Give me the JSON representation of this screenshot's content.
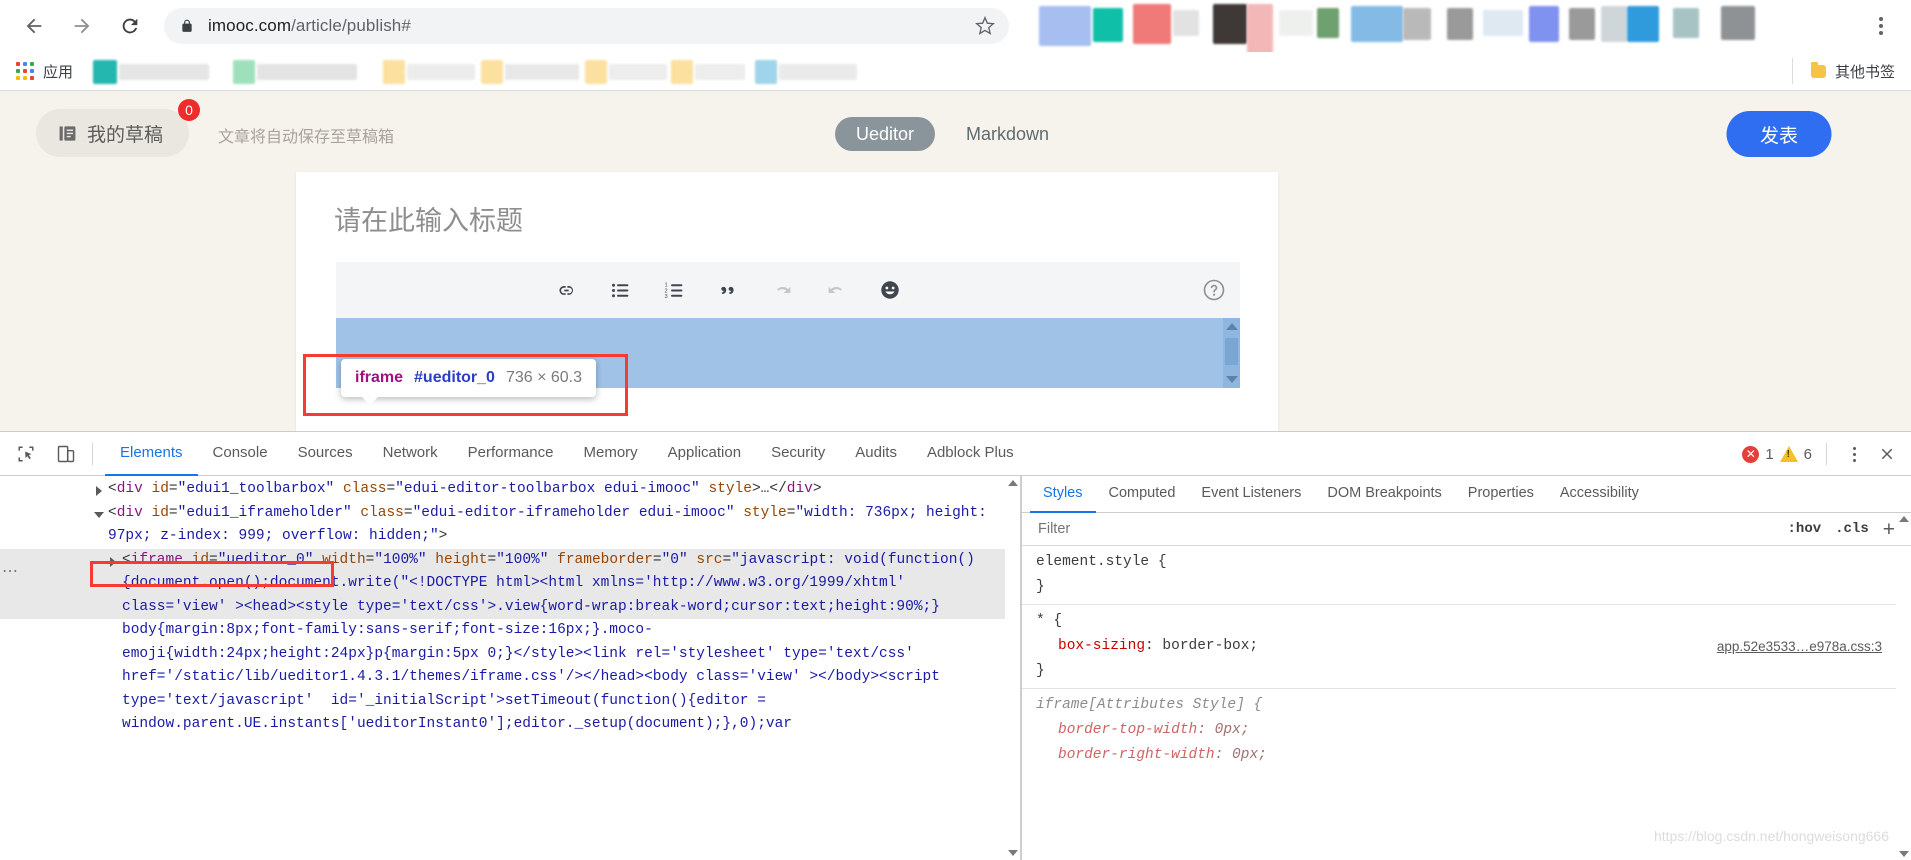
{
  "browser": {
    "back_icon": "back-arrow-icon",
    "forward_icon": "forward-arrow-icon",
    "reload_icon": "reload-icon",
    "lock_icon": "lock-icon",
    "url_domain": "imooc.com",
    "url_path": "/article/publish#",
    "star_icon": "bookmark-star-icon",
    "menu_icon": "browser-menu-icon",
    "apps_label": "应用",
    "other_bookmarks_label": "其他书签"
  },
  "page_header": {
    "draft_label": "我的草稿",
    "draft_badge": "0",
    "autosave_tip": "文章将自动保存至草稿箱",
    "mode_tabs": [
      {
        "label": "Ueditor",
        "active": true
      },
      {
        "label": "Markdown",
        "active": false
      }
    ],
    "publish_label": "发表",
    "accent_color": "#2f6ef0"
  },
  "editor": {
    "title_placeholder": "请在此输入标题",
    "toolbar_icons": [
      "link-icon",
      "bullet-list-icon",
      "numbered-list-icon",
      "blockquote-icon",
      "redo-icon",
      "undo-icon",
      "emoji-icon"
    ],
    "help_icon": "help-icon"
  },
  "inspector_tooltip": {
    "tag": "iframe",
    "id": "#ueditor_0",
    "dimensions": "736 × 60.3",
    "highlight_color": "#f53b34"
  },
  "devtools": {
    "inspect_icon": "inspect-element-icon",
    "device_icon": "device-toolbar-icon",
    "tabs": [
      {
        "label": "Elements",
        "active": true
      },
      {
        "label": "Console",
        "active": false
      },
      {
        "label": "Sources",
        "active": false
      },
      {
        "label": "Network",
        "active": false
      },
      {
        "label": "Performance",
        "active": false
      },
      {
        "label": "Memory",
        "active": false
      },
      {
        "label": "Application",
        "active": false
      },
      {
        "label": "Security",
        "active": false
      },
      {
        "label": "Audits",
        "active": false
      },
      {
        "label": "Adblock Plus",
        "active": false
      }
    ],
    "error_count": "1",
    "warning_count": "6",
    "more_icon": "devtools-menu-icon",
    "close_icon": "close-icon",
    "dom_lines": [
      {
        "id": "line-toolbarbox",
        "triangle": "closed",
        "indent": 1,
        "selected": false,
        "segments": [
          {
            "t": "punc",
            "s": "<"
          },
          {
            "t": "tag",
            "s": "div"
          },
          {
            "t": "punc",
            "s": " "
          },
          {
            "t": "attr",
            "s": "id"
          },
          {
            "t": "punc",
            "s": "="
          },
          {
            "t": "val",
            "s": "\"edui1_toolbarbox\""
          },
          {
            "t": "punc",
            "s": " "
          },
          {
            "t": "attr",
            "s": "class"
          },
          {
            "t": "punc",
            "s": "="
          },
          {
            "t": "val",
            "s": "\"edui-editor-toolbarbox edui-imooc\""
          },
          {
            "t": "punc",
            "s": " "
          },
          {
            "t": "attr",
            "s": "style"
          },
          {
            "t": "punc",
            "s": ">…</"
          },
          {
            "t": "tag",
            "s": "div"
          },
          {
            "t": "punc",
            "s": ">"
          }
        ]
      },
      {
        "id": "line-iframeholder",
        "triangle": "open",
        "indent": 1,
        "selected": false,
        "segments": [
          {
            "t": "punc",
            "s": "<"
          },
          {
            "t": "tag",
            "s": "div"
          },
          {
            "t": "punc",
            "s": " "
          },
          {
            "t": "attr",
            "s": "id"
          },
          {
            "t": "punc",
            "s": "="
          },
          {
            "t": "val",
            "s": "\"edui1_iframeholder\""
          },
          {
            "t": "punc",
            "s": " "
          },
          {
            "t": "attr",
            "s": "class"
          },
          {
            "t": "punc",
            "s": "="
          },
          {
            "t": "val",
            "s": "\"edui-editor-iframeholder edui-imooc\""
          },
          {
            "t": "punc",
            "s": " "
          },
          {
            "t": "attr",
            "s": "style"
          },
          {
            "t": "punc",
            "s": "="
          },
          {
            "t": "val",
            "s": "\"width: 736px; height: 97px; z-index: 999; overflow: hidden;\""
          },
          {
            "t": "punc",
            "s": ">"
          }
        ]
      },
      {
        "id": "line-iframe-ueditor0",
        "triangle": "closed",
        "indent": 2,
        "selected": true,
        "segments": [
          {
            "t": "punc",
            "s": "<"
          },
          {
            "t": "tag",
            "s": "iframe"
          },
          {
            "t": "punc",
            "s": " "
          },
          {
            "t": "attr",
            "s": "id"
          },
          {
            "t": "punc",
            "s": "="
          },
          {
            "t": "val",
            "s": "\"ueditor_0\""
          },
          {
            "t": "punc",
            "s": " "
          },
          {
            "t": "attr",
            "s": "width"
          },
          {
            "t": "punc",
            "s": "="
          },
          {
            "t": "val",
            "s": "\"100%\""
          },
          {
            "t": "punc",
            "s": " "
          },
          {
            "t": "attr",
            "s": "height"
          },
          {
            "t": "punc",
            "s": "="
          },
          {
            "t": "val",
            "s": "\"100%\""
          },
          {
            "t": "punc",
            "s": " "
          },
          {
            "t": "attr",
            "s": "frameborder"
          },
          {
            "t": "punc",
            "s": "="
          },
          {
            "t": "val",
            "s": "\"0\""
          },
          {
            "t": "punc",
            "s": " "
          },
          {
            "t": "attr",
            "s": "src"
          },
          {
            "t": "punc",
            "s": "="
          },
          {
            "t": "val",
            "s": "\"javascript: void(function(){document.open();document.write(\"<!DOCTYPE html><html xmlns='http://www.w3.org/1999/xhtml' class='view' ><head><style type='text/css'>.view{word-wrap:break-word;cursor:text;height:90%;}"
          }
        ]
      },
      {
        "id": "line-src-cont-1",
        "triangle": "none",
        "indent": 2,
        "selected": false,
        "segments": [
          {
            "t": "val",
            "s": "body{margin:8px;font-family:sans-serif;font-size:16px;}.moco-emoji{width:24px;height:24px}p{margin:5px 0;}</style><link rel='stylesheet' type='text/css' href='/static/lib/ueditor1.4.3.1/themes/iframe.css'/></head><body class='view' ></body><script"
          }
        ]
      },
      {
        "id": "line-src-cont-2",
        "triangle": "none",
        "indent": 2,
        "selected": false,
        "segments": [
          {
            "t": "val",
            "s": "type='text/javascript'  id='_initialScript'>setTimeout(function(){editor = window.parent.UE.instants['ueditorInstant0'];editor._setup(document);},0);var"
          }
        ]
      }
    ],
    "styles_panel": {
      "tabs": [
        {
          "label": "Styles",
          "active": true
        },
        {
          "label": "Computed",
          "active": false
        },
        {
          "label": "Event Listeners",
          "active": false
        },
        {
          "label": "DOM Breakpoints",
          "active": false
        },
        {
          "label": "Properties",
          "active": false
        },
        {
          "label": "Accessibility",
          "active": false
        }
      ],
      "filter_placeholder": "Filter",
      "hov_label": ":hov",
      "cls_label": ".cls",
      "plus_label": "+",
      "rules": [
        {
          "id": "rule-element-style",
          "selector": "element.style {",
          "close": "}",
          "source": "",
          "italic": false,
          "declarations": []
        },
        {
          "id": "rule-universal",
          "selector": "* {",
          "close": "}",
          "source": "app.52e3533…e978a.css:3",
          "italic": false,
          "declarations": [
            {
              "prop": "box-sizing",
              "value": "border-box;"
            }
          ]
        },
        {
          "id": "rule-iframe-attributes",
          "selector": "iframe[Attributes Style] {",
          "close": "",
          "source": "",
          "italic": true,
          "declarations": [
            {
              "prop": "border-top-width",
              "value": "0px;"
            },
            {
              "prop": "border-right-width",
              "value": "0px;"
            }
          ]
        }
      ]
    },
    "watermark": "https://blog.csdn.net/hongweisong666"
  }
}
